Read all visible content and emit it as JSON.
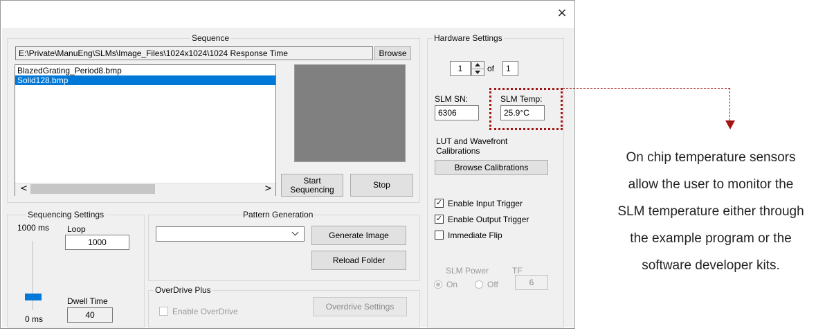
{
  "window": {
    "close_glyph": "×"
  },
  "sequence": {
    "group_label": "Sequence",
    "path_value": "E:\\Private\\ManuEng\\SLMs\\Image_Files\\1024x1024\\1024 Response Time",
    "browse_label": "Browse",
    "files": [
      {
        "name": "BlazedGrating_Period8.bmp",
        "selected": false
      },
      {
        "name": "Solid128.bmp",
        "selected": true
      }
    ],
    "preview_color": "#808080",
    "start_label_line1": "Start",
    "start_label_line2": "Sequencing",
    "stop_label": "Stop",
    "scroll_left": "<",
    "scroll_right": ">"
  },
  "hardware": {
    "group_label": "Hardware Settings",
    "board_index": "1",
    "of_label": "of",
    "board_count": "1",
    "sn_label": "SLM SN:",
    "sn_value": "6306",
    "temp_label": "SLM Temp:",
    "temp_value": "25.9°C",
    "calib_label_line1": "LUT and Wavefront",
    "calib_label_line2": "Calibrations",
    "browse_calib_label": "Browse Calibrations",
    "enable_input_trigger": {
      "label": "Enable Input Trigger",
      "checked": true
    },
    "enable_output_trigger": {
      "label": "Enable Output Trigger",
      "checked": true
    },
    "immediate_flip": {
      "label": "Immediate Flip",
      "checked": false
    },
    "slm_power_label": "SLM Power",
    "tf_label": "TF",
    "power_on_label": "On",
    "power_off_label": "Off",
    "power_selected": "On",
    "tf_value": "6"
  },
  "sequencing_settings": {
    "group_label": "Sequencing Settings",
    "slider_max_label": "1000 ms",
    "slider_min_label": "0 ms",
    "slider_level_fraction": 0.0,
    "loop_label": "Loop",
    "loop_value": "1000",
    "dwell_label": "Dwell Time",
    "dwell_value": "40"
  },
  "pattern_generation": {
    "group_label": "Pattern Generation",
    "dropdown_value": "",
    "generate_label": "Generate Image",
    "reload_label": "Reload Folder"
  },
  "overdrive": {
    "group_label": "OverDrive Plus",
    "enable_label": "Enable OverDrive",
    "enable_checked": false,
    "settings_label": "Overdrive Settings"
  },
  "callout": {
    "highlight_color": "#a31515",
    "lines": [
      "On chip temperature sensors",
      "allow the user to monitor the",
      "SLM temperature either through",
      "the example program or the",
      "software developer kits."
    ]
  },
  "colors": {
    "accent_selection": "#0078d7",
    "slider_thumb": "#0078d7"
  }
}
